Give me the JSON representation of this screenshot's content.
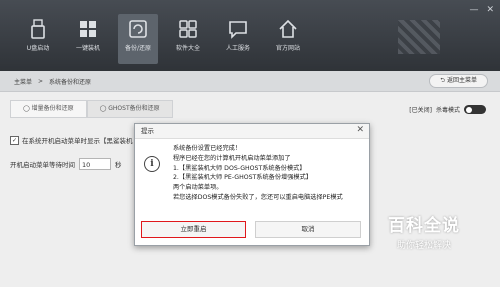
{
  "window": {
    "min": "—",
    "close": "✕"
  },
  "nav": [
    {
      "label": "U盘启动",
      "icon": "usb-icon"
    },
    {
      "label": "一键装机",
      "icon": "windows-icon"
    },
    {
      "label": "备份/还原",
      "icon": "backup-restore-icon"
    },
    {
      "label": "软件大全",
      "icon": "software-icon"
    },
    {
      "label": "人工服务",
      "icon": "chat-icon"
    },
    {
      "label": "官方网站",
      "icon": "home-icon"
    }
  ],
  "breadcrumb": {
    "home": "主菜单",
    "sep": ">",
    "current": "系统备份和还原"
  },
  "back_button": "返回主菜单",
  "tabs": [
    {
      "label": "增量备份和还原"
    },
    {
      "label": "GHOST备份和还原"
    }
  ],
  "pe_mode": {
    "status": "[已关闭]",
    "label": "杀毒模式"
  },
  "option": {
    "label": "在系统开机启动菜单时显示【黑鲨装机"
  },
  "wait": {
    "label": "开机启动菜单等待时间",
    "value": "10",
    "unit": "秒"
  },
  "dialog": {
    "title": "提示",
    "close": "✕",
    "icon": "i",
    "lines": [
      "系统备份设置已经完成！",
      "程序已经在您的计算机开机启动菜单添加了",
      "1.【黑鲨装机大师 DOS-GHOST系统备份模式】",
      "2.【黑鲨装机大师 PE-GHOST系统备份增强模式】",
      "两个启动菜单项。",
      "若您选择DOS模式备份失败了，您还可以重启电脑选择PE模式"
    ],
    "restart": "立即重启",
    "cancel": "取消"
  },
  "watermark": {
    "title": "百科全说",
    "subtitle": "助你轻松解决"
  }
}
